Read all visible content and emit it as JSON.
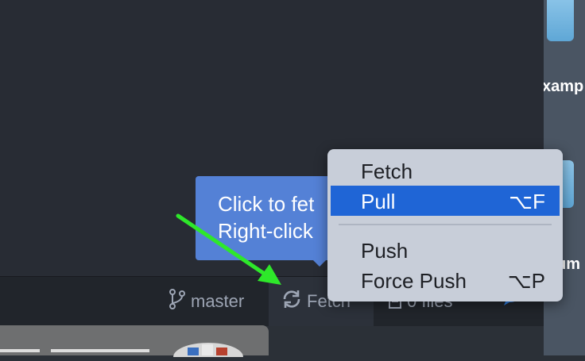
{
  "desktop": {
    "labels": [
      "xamp",
      "um"
    ]
  },
  "status_bar": {
    "branch": "master",
    "fetch": "Fetch",
    "files": "0 files"
  },
  "tooltip": {
    "line1": "Click to fet",
    "line2": "Right-click"
  },
  "menu": {
    "items": [
      {
        "label": "Fetch",
        "shortcut": ""
      },
      {
        "label": "Pull",
        "shortcut": "⌥F"
      },
      {
        "label": "Push",
        "shortcut": ""
      },
      {
        "label": "Force Push",
        "shortcut": "⌥P"
      }
    ],
    "selected_index": 1
  },
  "icons": [
    "git-branch-icon",
    "sync-icon",
    "file-icon",
    "chat-icon",
    "arrow-annotation"
  ],
  "colors": {
    "menu_highlight": "#1f65d6",
    "tooltip": "#5481d6",
    "annotation_arrow": "#2ee82a"
  }
}
